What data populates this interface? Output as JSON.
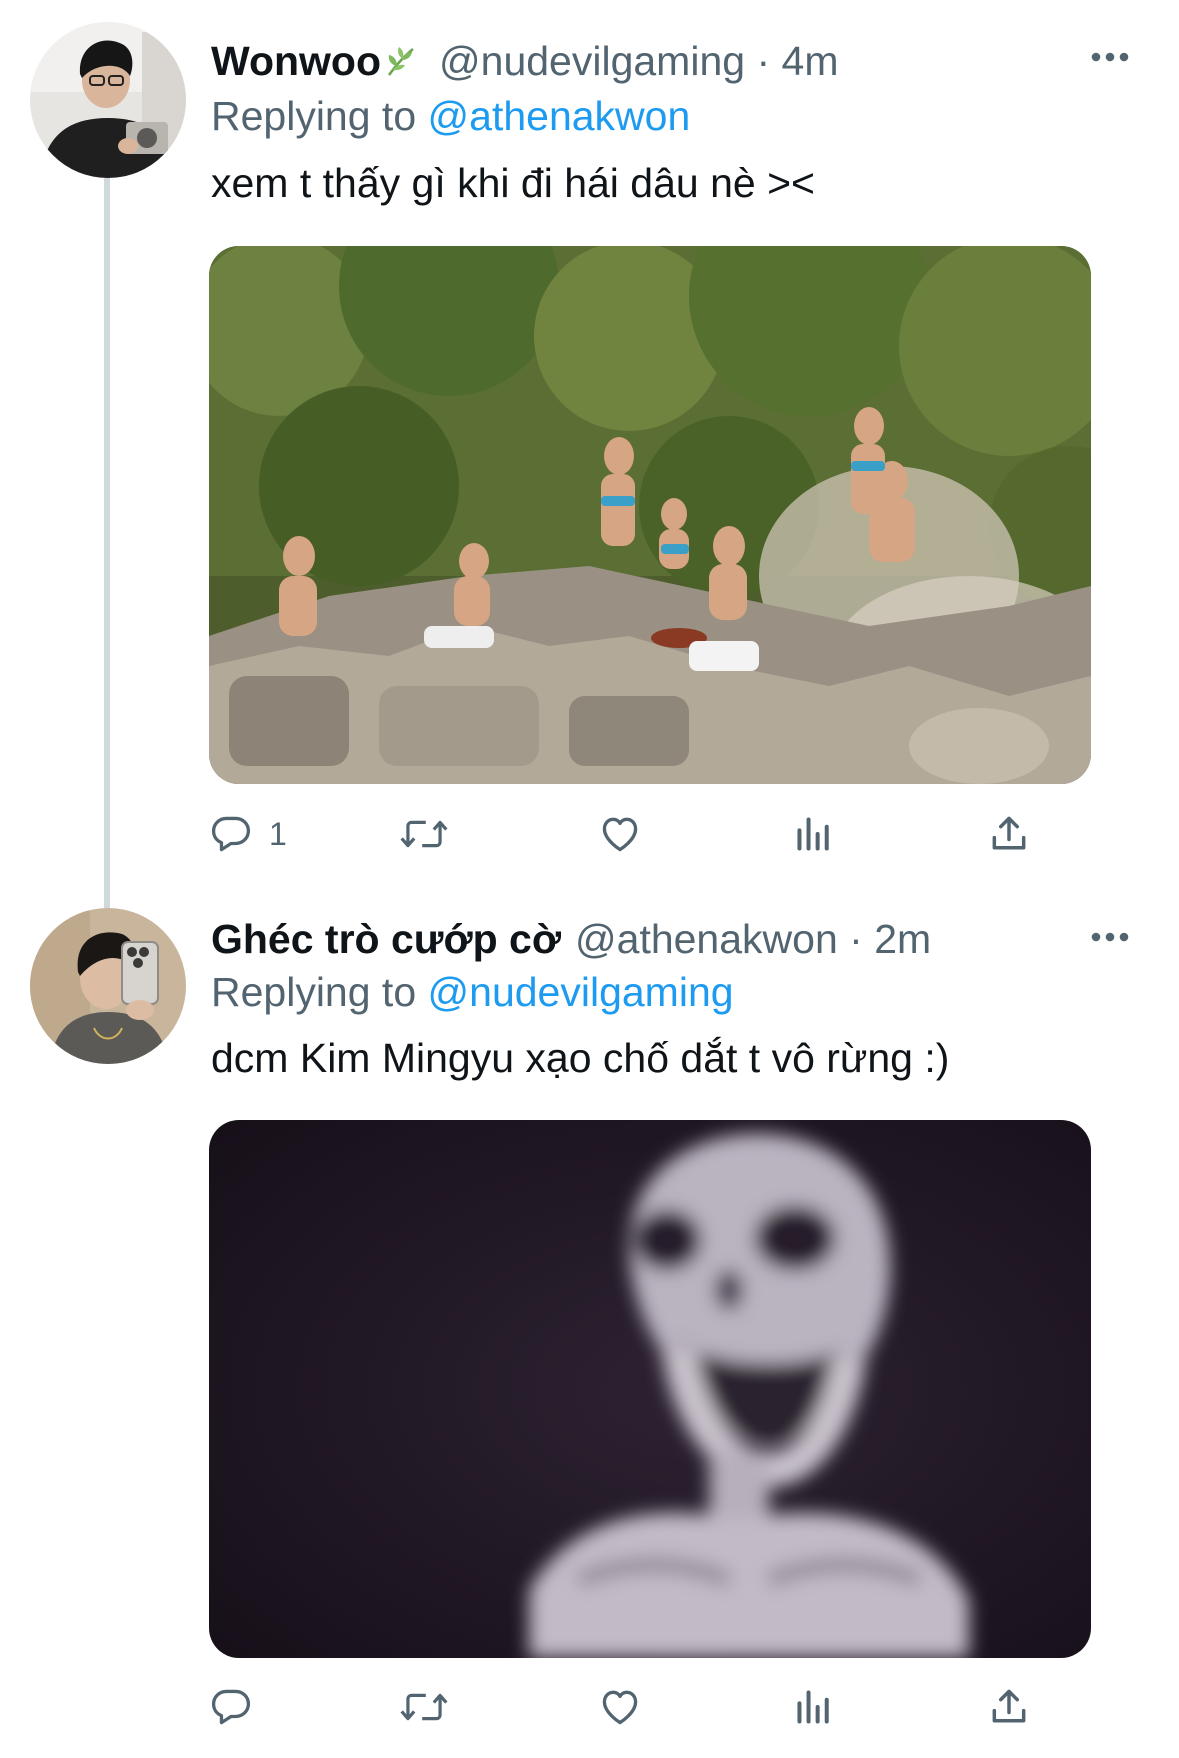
{
  "tweets": [
    {
      "display_name": "Wonwoo",
      "handle": "@nudevilgaming",
      "separator": "·",
      "time": "4m",
      "replying_prefix": "Replying to",
      "replying_to": "@athenakwon",
      "text": "xem t thấy gì khi đi hái dâu nè ><",
      "media": "photo-women-on-rocks",
      "actions": {
        "reply_count": "1"
      }
    },
    {
      "display_name": "Ghéc trò cướp cờ",
      "handle": "@athenakwon",
      "separator": "·",
      "time": "2m",
      "replying_prefix": "Replying to",
      "replying_to": "@nudevilgaming",
      "text": "dcm Kim Mingyu xạo chố dắt t vô rừng :)",
      "media": "photo-blurry-skeleton",
      "actions": {
        "reply_count": ""
      }
    }
  ],
  "icons": {
    "name_badge": "leaf-icon",
    "more": "more-options-icon",
    "reply": "reply-icon",
    "retweet": "retweet-icon",
    "like": "like-icon",
    "views": "views-icon",
    "share": "share-icon"
  },
  "colors": {
    "text_primary": "#0f1419",
    "text_secondary": "#536471",
    "accent": "#1d9bf0",
    "thread_line": "#cfd9de",
    "leaf_green": "#6ba34f"
  }
}
